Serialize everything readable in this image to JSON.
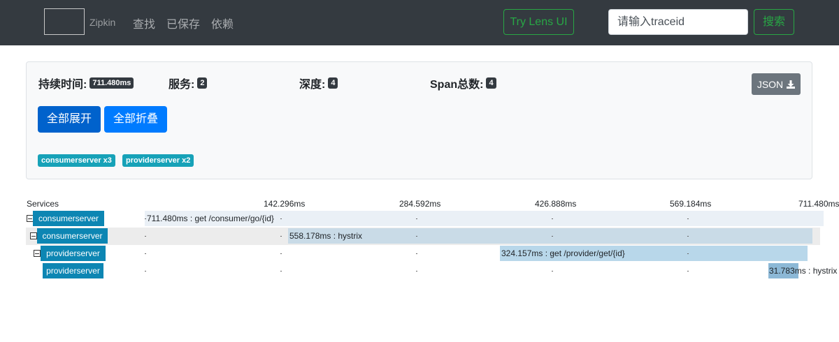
{
  "navbar": {
    "brand": "Zipkin",
    "links": [
      "查找",
      "已保存",
      "依赖"
    ],
    "lens_button": "Try Lens UI",
    "search_placeholder": "请输入traceid",
    "search_button": "搜索"
  },
  "summary": {
    "duration_label": "持续时间:",
    "duration_value": "711.480ms",
    "services_label": "服务:",
    "services_value": "2",
    "depth_label": "深度:",
    "depth_value": "4",
    "spans_label": "Span总数:",
    "spans_value": "4",
    "json_button": "JSON",
    "expand_all": "全部展开",
    "collapse_all": "全部折叠",
    "service_badges": [
      "consumerserver x3",
      "providerserver x2"
    ]
  },
  "timeline": {
    "services_header": "Services",
    "ticks": [
      "142.296ms",
      "284.592ms",
      "426.888ms",
      "569.184ms",
      "711.480ms"
    ],
    "spans": [
      {
        "service": "consumerserver",
        "label": "711.480ms : get /consumer/go/{id}"
      },
      {
        "service": "consumerserver",
        "label": "558.178ms : hystrix"
      },
      {
        "service": "providerserver",
        "label": "324.157ms : get /provider/get/{id}"
      },
      {
        "service": "providerserver",
        "label": "31.783ms : hystrix"
      }
    ]
  },
  "colors": {
    "navbar_bg": "#343a40",
    "success": "#28a745",
    "primary": "#0069d9",
    "info": "#17a2b8",
    "service_label": "#0d86b3"
  }
}
